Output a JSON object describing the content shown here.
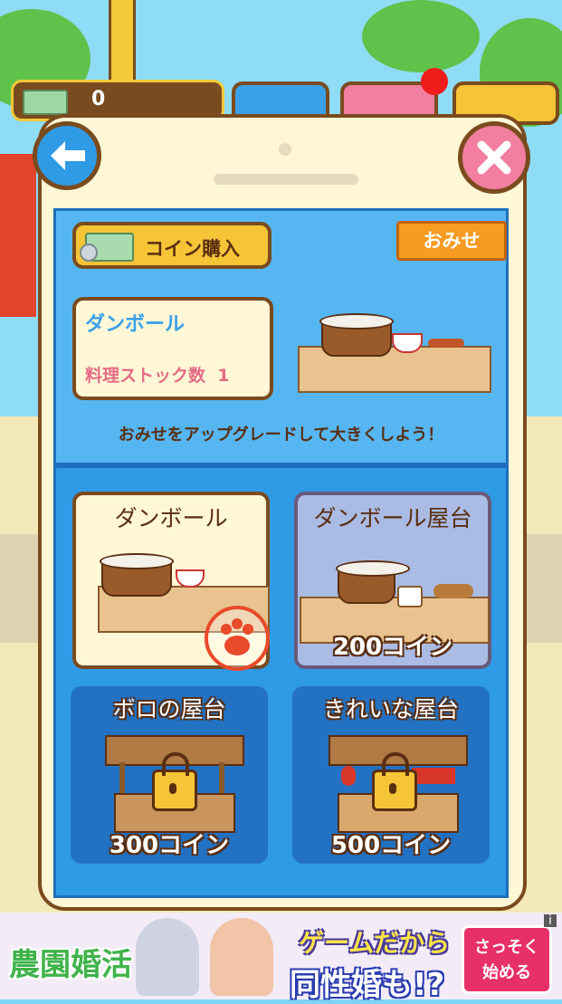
{
  "hud": {
    "coin_count": "0"
  },
  "header": {
    "buy_coins_label": "コイン購入",
    "shop_button_label": "おみせ"
  },
  "current_shop": {
    "name": "ダンボール",
    "stock_label": "料理ストック数",
    "stock_value": "1"
  },
  "hint": "おみせをアップグレードして大きくしよう！",
  "upgrades": [
    {
      "name": "ダンボール",
      "price": "",
      "owned": true,
      "locked": false
    },
    {
      "name": "ダンボール屋台",
      "price": "200コイン",
      "owned": false,
      "locked": false
    },
    {
      "name": "ボロの屋台",
      "price": "300コイン",
      "owned": false,
      "locked": true
    },
    {
      "name": "きれいな屋台",
      "price": "500コイン",
      "owned": false,
      "locked": true
    }
  ],
  "ad": {
    "brand": "農園婚活",
    "headline_1": "ゲームだから",
    "headline_2": "同性婚も!?",
    "cta_line1": "さっそく",
    "cta_line2": "始める",
    "info": "i"
  },
  "colors": {
    "panel_blue": "#2f9ae6",
    "dialog_cream": "#fff7d6",
    "outline_brown": "#7a4b1e",
    "accent_orange": "#f79b22"
  },
  "icons": [
    "back-arrow-icon",
    "close-icon",
    "banknote-icon",
    "paw-icon",
    "lock-icon"
  ]
}
